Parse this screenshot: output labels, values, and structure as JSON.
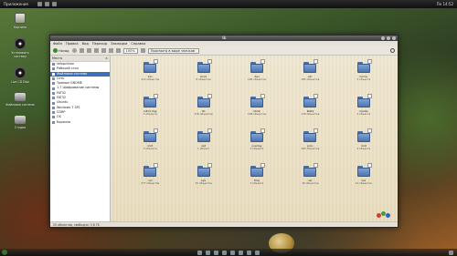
{
  "topbar": {
    "left_label": "Приложения",
    "right_label": "Пн 14:52"
  },
  "desktop": {
    "icons": [
      {
        "label": "Корзина",
        "icon": "trash-icon"
      },
      {
        "label": "Установить систему",
        "icon": "install-disc-icon"
      },
      {
        "label": "Live CD Disk",
        "icon": "cd-icon"
      },
      {
        "label": "Файловая система",
        "icon": "drive-icon"
      },
      {
        "label": "Студия",
        "icon": "drive-icon"
      }
    ]
  },
  "window": {
    "title": "lib",
    "menu": [
      "Файл",
      "Правка",
      "Вид",
      "Переход",
      "Закладки",
      "Справка"
    ],
    "toolbar": {
      "back_label": "Назад",
      "forward_label": "Вперёд",
      "zoom_value": "100%",
      "view_select": "Просмотр в виде значков"
    },
    "sidebar": {
      "header": "Места",
      "items": [
        {
          "label": "rafopvilvan",
          "selected": false
        },
        {
          "label": "Рабочий стол",
          "selected": false
        },
        {
          "label": "Файловая система",
          "selected": true
        },
        {
          "label": "Сеть",
          "selected": false
        },
        {
          "label": "Трюмон GNOME",
          "selected": false
        },
        {
          "label": "1.7 Шифрование системы",
          "selected": false
        },
        {
          "label": "FAT32",
          "selected": false
        },
        {
          "label": "FAT32",
          "selected": false
        },
        {
          "label": "Ubuntu",
          "selected": false
        },
        {
          "label": "Windows 7 SP1",
          "selected": false
        },
        {
          "label": "CDRP",
          "selected": false
        },
        {
          "label": "OS",
          "selected": false
        },
        {
          "label": "Корзина",
          "selected": false
        }
      ]
    },
    "folders": [
      {
        "name": "bin",
        "count": "112 объектов"
      },
      {
        "name": "boot",
        "count": "8 объектов"
      },
      {
        "name": "dev",
        "count": "196 объектов"
      },
      {
        "name": "etc",
        "count": "185 объектов"
      },
      {
        "name": "home",
        "count": "3 объекта"
      },
      {
        "name": "initrd.img",
        "count": "3 объекта"
      },
      {
        "name": "lib",
        "count": "276 объектов"
      },
      {
        "name": "lib32",
        "count": "198 объектов"
      },
      {
        "name": "lib64",
        "count": "178 объектов"
      },
      {
        "name": "media",
        "count": "4 объекта"
      },
      {
        "name": "mnt",
        "count": "3 объекта"
      },
      {
        "name": "opt",
        "count": "1 объект"
      },
      {
        "name": "overlay",
        "count": "3 объекта"
      },
      {
        "name": "proc",
        "count": "165 объектов"
      },
      {
        "name": "root",
        "count": "4 объекта"
      },
      {
        "name": "run",
        "count": "277 объектов"
      },
      {
        "name": "sys",
        "count": "15 объектов"
      },
      {
        "name": "tmp",
        "count": "3 объекта"
      },
      {
        "name": "usr",
        "count": "16 объектов"
      },
      {
        "name": "var",
        "count": "14 объектов"
      }
    ],
    "status": "20 объектов, свободно: 3,8 ГБ"
  },
  "dock": {
    "clock": ""
  }
}
